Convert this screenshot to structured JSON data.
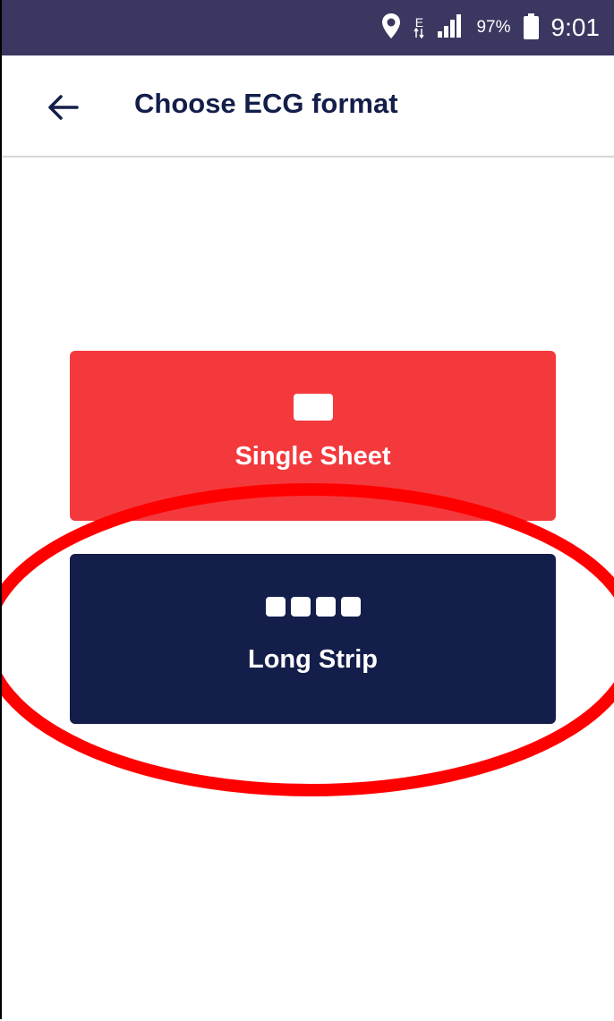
{
  "status_bar": {
    "battery_percent": "97%",
    "time": "9:01",
    "network_type": "E",
    "icons": [
      "location-pin-icon",
      "data-arrows-icon",
      "signal-icon",
      "battery-icon"
    ]
  },
  "app_bar": {
    "back_icon": "arrow-left-icon",
    "title": "Choose ECG format"
  },
  "options": [
    {
      "label": "Single Sheet",
      "icon": "single-sheet-icon",
      "color": "#f4393d"
    },
    {
      "label": "Long Strip",
      "icon": "long-strip-icon",
      "color": "#141e4a"
    }
  ],
  "annotation": {
    "shape": "ellipse",
    "color": "#ff0000",
    "highlights": "Long Strip"
  }
}
